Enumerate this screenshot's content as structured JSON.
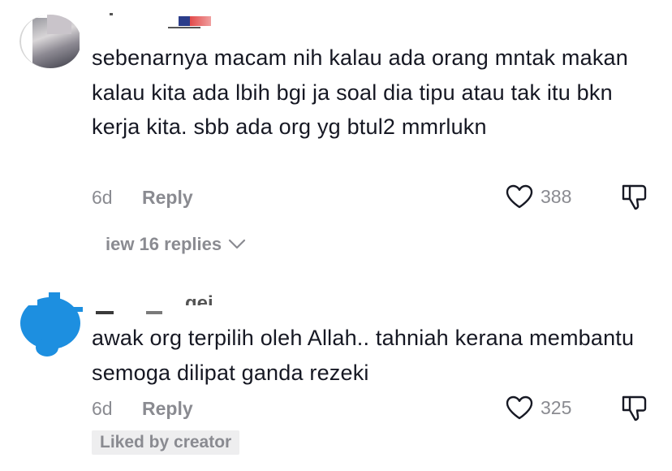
{
  "comments": [
    {
      "avatar": "user-avatar-photo",
      "text": "sebenarnya macam nih kalau ada orang mntak makan kalau kita ada lbih bgi ja soal dia tipu atau tak itu bkn kerja kita. sbb ada org yg btul2 mmrlukn",
      "time": "6d",
      "reply_label": "Reply",
      "likes": "388",
      "view_replies": "iew 16 replies",
      "icons": {
        "like": "heart-outline-icon",
        "dislike": "thumbs-down-icon",
        "expand": "chevron-down-icon"
      }
    },
    {
      "avatar": "user-avatar-blue",
      "username_fragment": "gei",
      "text": "awak org terpilih oleh Allah.. tahniah kerana membantu semoga dilipat ganda rezeki",
      "time": "6d",
      "reply_label": "Reply",
      "likes": "325",
      "liked_by_creator": "Liked by creator",
      "icons": {
        "like": "heart-outline-icon",
        "dislike": "thumbs-down-icon"
      }
    }
  ],
  "colors": {
    "text": "#161823",
    "muted": "#8a8b91",
    "avatar_blue": "#1d8fe0",
    "badge_bg": "#eeeeef"
  }
}
